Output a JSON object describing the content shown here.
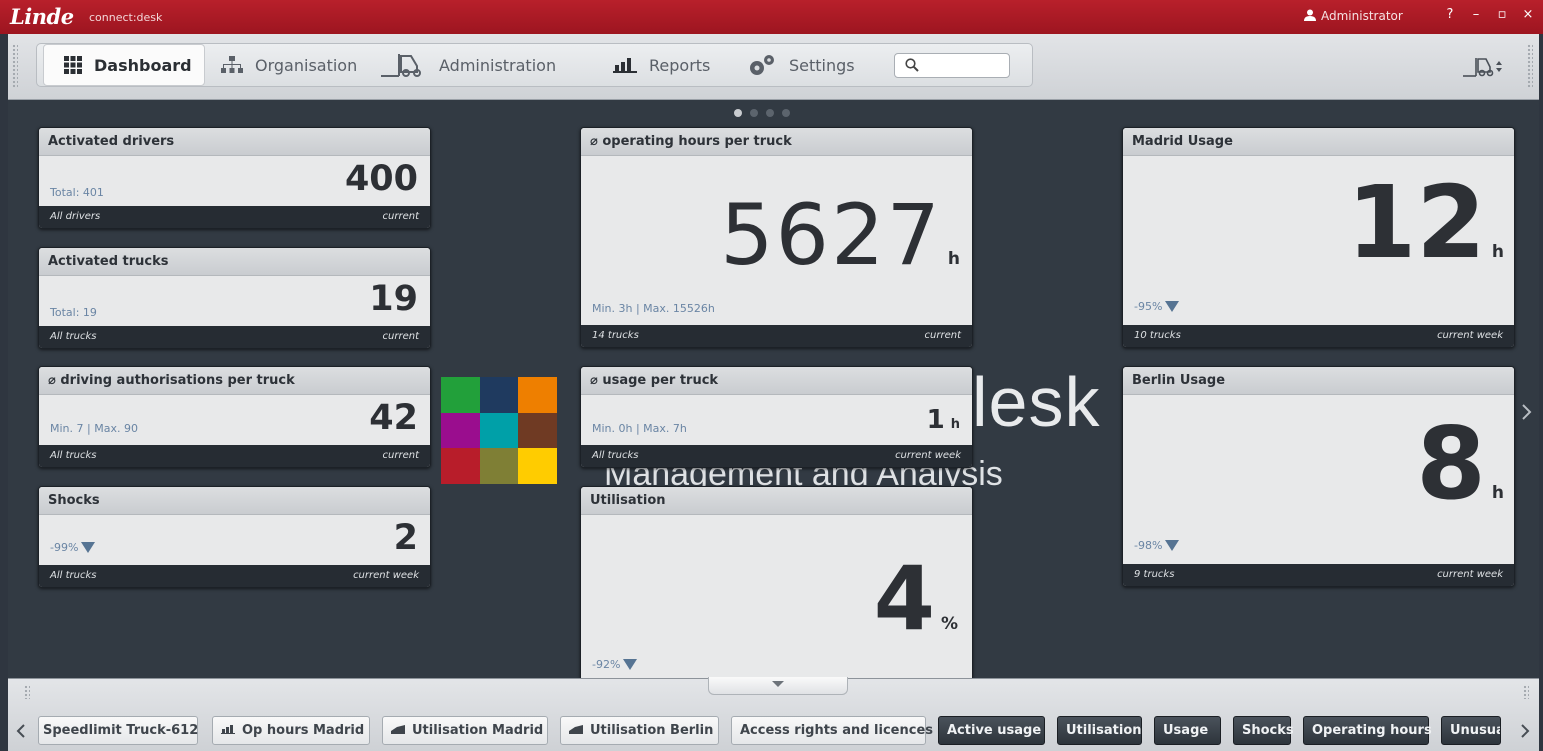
{
  "titlebar": {
    "logo": "Linde",
    "app_name": "connect:desk",
    "user": "Administrator",
    "help": "?",
    "minimize": "–",
    "maximize": "▫",
    "close": "×"
  },
  "nav": {
    "tabs": [
      {
        "label": "Dashboard",
        "icon": "grid-icon",
        "active": true
      },
      {
        "label": "Organisation",
        "icon": "org-chart-icon",
        "active": false
      },
      {
        "label": "Administration",
        "icon": "forklift-icon",
        "active": false
      },
      {
        "label": "Reports",
        "icon": "bar-chart-icon",
        "active": false
      },
      {
        "label": "Settings",
        "icon": "gears-icon",
        "active": false
      }
    ],
    "search_placeholder": ""
  },
  "colors": {
    "brand_red": "#a8182a",
    "mosaic": [
      "#22a03a",
      "#1f3a5f",
      "#ee7f00",
      "#9a0d8e",
      "#00a0a8",
      "#6f3a23",
      "#b81d2a",
      "#7f7f35",
      "#ffcc00"
    ]
  },
  "splash": {
    "text": "lesk",
    "subtitle": "Management and Analysis"
  },
  "widgets": {
    "activated_drivers": {
      "title": "Activated drivers",
      "meta": "Total: 401",
      "value": "400",
      "unit": "",
      "foot_left": "All drivers",
      "foot_right": "current"
    },
    "activated_trucks": {
      "title": "Activated trucks",
      "meta": "Total: 19",
      "value": "19",
      "unit": "",
      "foot_left": "All trucks",
      "foot_right": "current"
    },
    "driving_auth": {
      "title": "⌀ driving authorisations per truck",
      "meta": "Min. 7 | Max. 90",
      "value": "42",
      "unit": "",
      "foot_left": "All trucks",
      "foot_right": "current"
    },
    "shocks": {
      "title": "Shocks",
      "meta": "-99%",
      "value": "2",
      "unit": "",
      "foot_left": "All trucks",
      "foot_right": "current week"
    },
    "op_hours": {
      "title": "⌀ operating hours per truck",
      "meta": "Min. 3h | Max. 15526h",
      "value": "5627",
      "unit": "h",
      "foot_left": "14 trucks",
      "foot_right": "current"
    },
    "usage_truck": {
      "title": "⌀ usage per truck",
      "meta": "Min. 0h | Max. 7h",
      "value": "1",
      "unit": "h",
      "foot_left": "All trucks",
      "foot_right": "current week"
    },
    "utilisation": {
      "title": "Utilisation",
      "meta": "-92%",
      "value": "4",
      "unit": "%"
    },
    "madrid": {
      "title": "Madrid Usage",
      "meta": "-95%",
      "value": "12",
      "unit": "h",
      "foot_left": "10 trucks",
      "foot_right": "current week"
    },
    "berlin": {
      "title": "Berlin Usage",
      "meta": "-98%",
      "value": "8",
      "unit": "h",
      "foot_left": "9 trucks",
      "foot_right": "current week"
    }
  },
  "bottom_chips": [
    {
      "label": "Speedlimit Truck-612",
      "style": "light",
      "icon": ""
    },
    {
      "label": "Op hours Madrid",
      "style": "light",
      "icon": "bar-chart-icon"
    },
    {
      "label": "Utilisation Madrid",
      "style": "light",
      "icon": "area-chart-icon"
    },
    {
      "label": "Utilisation Berlin",
      "style": "light",
      "icon": "area-chart-icon"
    },
    {
      "label": "Access rights and licences",
      "style": "light",
      "icon": ""
    },
    {
      "label": "Active usage",
      "style": "dark",
      "icon": ""
    },
    {
      "label": "Utilisation",
      "style": "dark",
      "icon": ""
    },
    {
      "label": "Usage",
      "style": "dark",
      "icon": ""
    },
    {
      "label": "Shocks",
      "style": "dark",
      "icon": ""
    },
    {
      "label": "Operating hours",
      "style": "dark",
      "icon": ""
    },
    {
      "label": "Unusual",
      "style": "dark",
      "icon": ""
    }
  ]
}
